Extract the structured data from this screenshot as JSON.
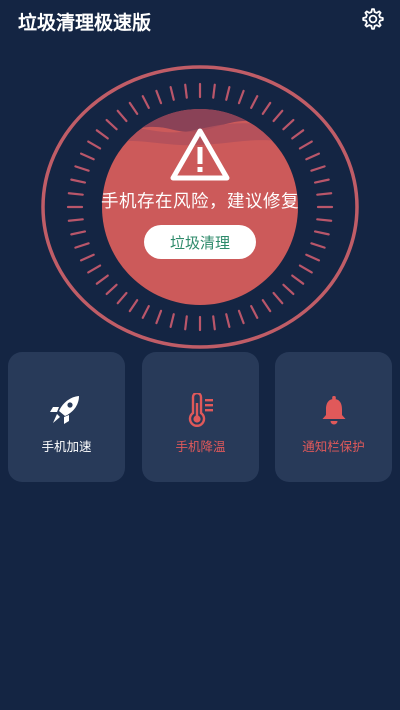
{
  "header": {
    "title": "垃圾清理极速版",
    "settings_icon": "gear-icon"
  },
  "status": {
    "warning_icon": "warning-triangle-icon",
    "message": "手机存在风险，建议修复",
    "clean_button_label": "垃圾清理",
    "accent_color": "#cc5a5a"
  },
  "features": [
    {
      "label": "手机加速",
      "icon": "rocket-icon",
      "color": "#ffffff"
    },
    {
      "label": "手机降温",
      "icon": "thermometer-icon",
      "color": "#e0595a"
    },
    {
      "label": "通知栏保护",
      "icon": "bell-icon",
      "color": "#e0595a"
    }
  ]
}
